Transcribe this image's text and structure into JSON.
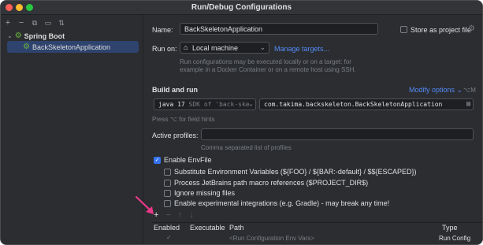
{
  "window": {
    "title": "Run/Debug Configurations",
    "traffic_colors": [
      "#ff5f57",
      "#febc2e",
      "#28c840"
    ]
  },
  "sidebar": {
    "toolbar_icons": [
      {
        "name": "add-icon",
        "glyph": "+"
      },
      {
        "name": "remove-icon",
        "glyph": "−"
      },
      {
        "name": "copy-icon",
        "glyph": "⧉"
      },
      {
        "name": "folder-icon",
        "glyph": "▭"
      },
      {
        "name": "sort-icon",
        "glyph": "⇅"
      }
    ],
    "group_label": "Spring Boot",
    "item_label": "BackSkeletonApplication"
  },
  "form": {
    "name_label": "Name:",
    "name_value": "BackSkeletonApplication",
    "store_label": "Store as project file",
    "run_on_label": "Run on:",
    "run_on_value": "Local machine",
    "manage_targets": "Manage targets...",
    "run_hint_line1": "Run configurations may be executed locally or on a target: for",
    "run_hint_line2": "example in a Docker Container or on a remote host using SSH.",
    "build_run_label": "Build and run",
    "modify_options": "Modify options",
    "modify_shortcut": "⌥M",
    "jdk_version": "java 17",
    "jdk_detail": "SDK of 'back-ske",
    "main_class": "com.takima.backskeleton.BackSkeletonApplication",
    "field_hints": "Press ⌥ for field hints",
    "profiles_label": "Active profiles:",
    "profiles_hint": "Comma separated list of profiles"
  },
  "envfile": {
    "enable_label": "Enable EnvFile",
    "options": [
      "Substitute Environment Variables (${FOO} / ${BAR:-default} / $${ESCAPED})",
      "Process JetBrains path macro references ($PROJECT_DIR$)",
      "Ignore missing files",
      "Enable experimental integrations (e.g. Gradle) - may break any time!"
    ],
    "table_toolbar": [
      "+",
      "−",
      "↑",
      "↓"
    ],
    "columns": [
      "Enabled",
      "Executable",
      "Path",
      "Type"
    ],
    "row": {
      "enabled": "✓",
      "path": "<Run Configuration Env Vars>",
      "type": "Run Config"
    }
  },
  "colors": {
    "accent": "#3574f0",
    "annotation_arrow": "#e8388a"
  }
}
